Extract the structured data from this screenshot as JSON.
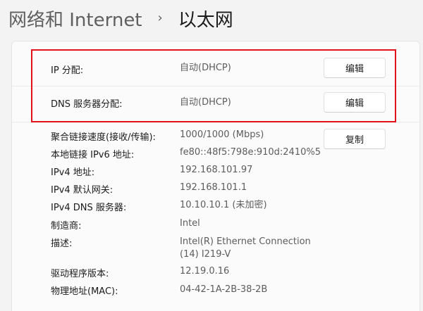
{
  "breadcrumb": {
    "parent": "网络和 Internet",
    "separator": "›",
    "current": "以太网"
  },
  "assignments": [
    {
      "label": "IP 分配:",
      "value": "自动(DHCP)",
      "button": "编辑"
    },
    {
      "label": "DNS 服务器分配:",
      "value": "自动(DHCP)",
      "button": "编辑"
    }
  ],
  "copy_button": "复制",
  "properties": [
    {
      "label": "聚合链接速度(接收/传输):",
      "value": "1000/1000 (Mbps)"
    },
    {
      "label": "本地链接 IPv6 地址:",
      "value": "fe80::48f5:798e:910d:2410%5"
    },
    {
      "label": "IPv4 地址:",
      "value": "192.168.101.97"
    },
    {
      "label": "IPv4 默认网关:",
      "value": "192.168.101.1"
    },
    {
      "label": "IPv4 DNS 服务器:",
      "value": "10.10.10.1 (未加密)"
    },
    {
      "label": "制造商:",
      "value": "Intel"
    },
    {
      "label": "描述:",
      "value_line1": "Intel(R) Ethernet Connection",
      "value_line2": "(14) I219-V"
    },
    {
      "label": "驱动程序版本:",
      "value": "12.19.0.16"
    },
    {
      "label": "物理地址(MAC):",
      "value": "04-42-1A-2B-38-2B"
    }
  ],
  "colors": {
    "highlight": "#e0121b",
    "background": "#f3f3f3",
    "card": "#fbfbfb"
  }
}
